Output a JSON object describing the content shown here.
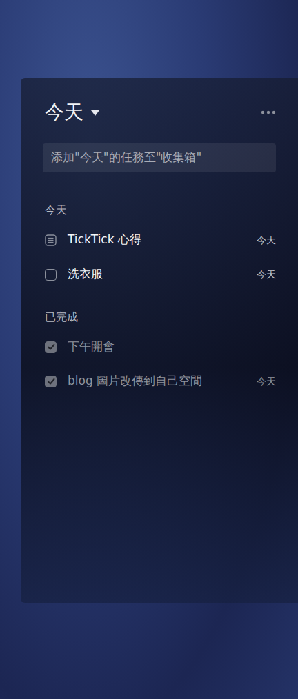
{
  "header": {
    "title": "今天"
  },
  "input": {
    "placeholder": "添加\"今天\"的任務至\"收集箱\""
  },
  "sections": [
    {
      "title": "今天",
      "tasks": [
        {
          "title": "TickTick 心得",
          "date": "今天",
          "kind": "note",
          "checked": false
        },
        {
          "title": "洗衣服",
          "date": "今天",
          "kind": "checkbox",
          "checked": false
        }
      ]
    },
    {
      "title": "已完成",
      "tasks": [
        {
          "title": "下午開會",
          "kind": "checkbox",
          "checked": true
        },
        {
          "title": "blog 圖片改傳到自己空間",
          "date": "今天",
          "kind": "checkbox",
          "checked": true
        }
      ]
    }
  ]
}
